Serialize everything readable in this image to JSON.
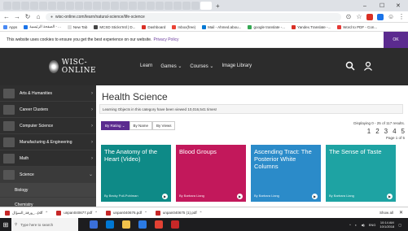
{
  "browser": {
    "url": "wisc-online.com/learn/natural-science/life-science",
    "bookmarks": [
      {
        "label": "Apps",
        "color": "#4a8af4"
      },
      {
        "label": "الصفحة الرئيسية - ...",
        "color": "#1a73e8"
      },
      {
        "label": "New Tab",
        "color": "#ddd"
      },
      {
        "label": "MCSD Sticks'Intl | D...",
        "color": "#444"
      },
      {
        "label": "Dashboard",
        "color": "#d93025"
      },
      {
        "label": "Inbox(free)",
        "color": "#ea4335"
      },
      {
        "label": "Mail - Ahmed.abou...",
        "color": "#0078d4"
      },
      {
        "label": "google translate -...",
        "color": "#34a853"
      },
      {
        "label": "Yandex.Translate -...",
        "color": "#d93025"
      },
      {
        "label": "Word to PDF - Con...",
        "color": "#e53935"
      }
    ]
  },
  "cookie": {
    "text": "This website uses cookies to ensure you get the best experience on our website.",
    "link": "Privacy Policy",
    "ok": "OK"
  },
  "header": {
    "logo": "WISC-ONLINE",
    "nav": [
      "Learn",
      "Games ⌄",
      "Courses ⌄",
      "Image Library"
    ]
  },
  "sidebar": {
    "items": [
      {
        "label": "Arts & Humanities"
      },
      {
        "label": "Career Clusters"
      },
      {
        "label": "Computer Science"
      },
      {
        "label": "Manufacturing & Engineering"
      },
      {
        "label": "Math"
      },
      {
        "label": "Science"
      }
    ],
    "subitems": [
      "Biology",
      "Chemistry"
    ]
  },
  "main": {
    "title": "Health Science",
    "count_text": "Learning Objects in this category have been viewed 10,016,541 times!",
    "sort": [
      "By Rating ⌄",
      "By Name",
      "By Views"
    ],
    "displaying": "Displaying 0 - 25 of 117 results.",
    "pages": [
      "1",
      "2",
      "3",
      "4",
      "5"
    ],
    "page_of": "Page 1 of 5",
    "cards": [
      {
        "title": "The Anatomy of the Heart (Video)",
        "author": "By Becky Poll-Pohlman",
        "color": "#0e8a87"
      },
      {
        "title": "Blood Groups",
        "author": "By Barbara Liang",
        "color": "#c2185b"
      },
      {
        "title": "Ascending Tract: The Posterior White Columns",
        "author": "By Barbara Liang",
        "color": "#2b8bc9"
      },
      {
        "title": "The Sense of Taste",
        "author": "By Barbara Liang",
        "color": "#1ea3a3"
      }
    ]
  },
  "downloads": {
    "items": [
      "ورقة_السؤال_...pdf",
      "unpan040677.pdf",
      "unpan040676.pdf",
      "unpan040675 (1).pdf"
    ],
    "show_all": "Show all"
  },
  "taskbar": {
    "search": "Type here to search",
    "time": "10:14 AM",
    "date": "10/1/2018",
    "lang": "ENG"
  }
}
